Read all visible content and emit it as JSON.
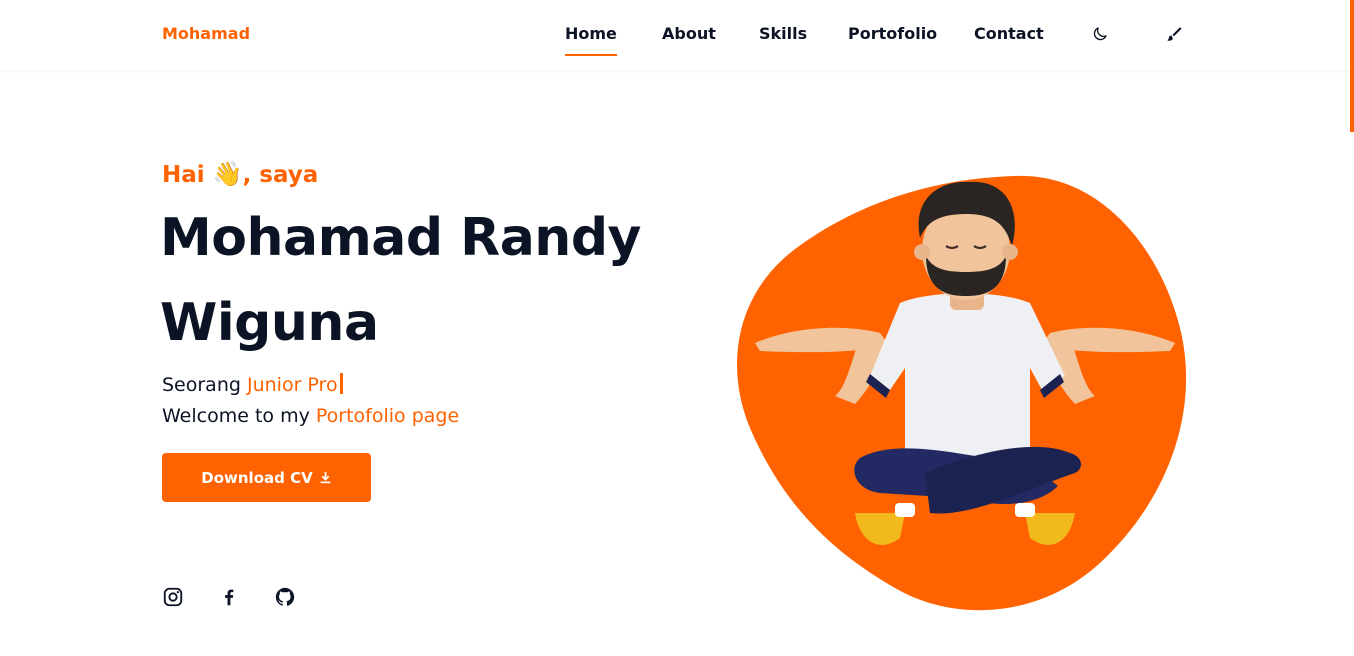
{
  "brand": "Mohamad",
  "nav": {
    "items": [
      {
        "label": "Home",
        "active": true
      },
      {
        "label": "About",
        "active": false
      },
      {
        "label": "Skills",
        "active": false
      },
      {
        "label": "Portofolio",
        "active": false
      },
      {
        "label": "Contact",
        "active": false
      }
    ],
    "icons": [
      "moon-icon",
      "brush-icon"
    ]
  },
  "hero": {
    "greeting_prefix": "Hai",
    "greeting_emoji": "👋",
    "greeting_suffix": ", saya",
    "name_line1": "Mohamad Randy",
    "name_line2": "Wiguna",
    "role_prefix": "Seorang",
    "role_typed": "Junior Pro",
    "welcome_prefix": "Welcome to my",
    "welcome_accent": "Portofolio page",
    "download_label": "Download CV"
  },
  "socials": [
    "instagram-icon",
    "facebook-icon",
    "github-icon"
  ],
  "colors": {
    "accent": "#ff6200",
    "text": "#0b1324",
    "background": "#ffffff"
  }
}
